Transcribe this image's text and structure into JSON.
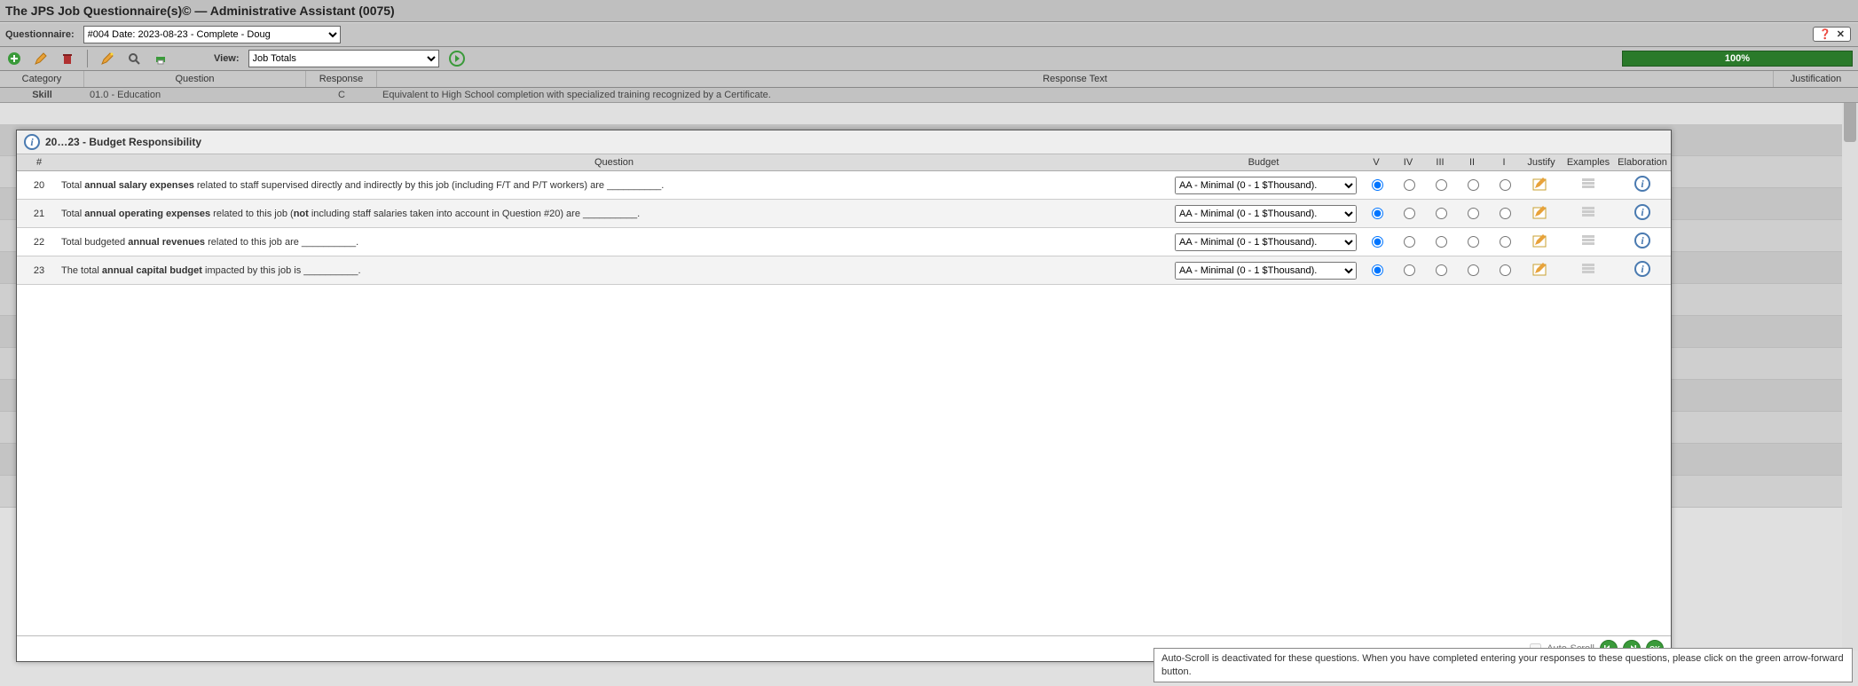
{
  "app": {
    "title": "The JPS Job Questionnaire(s)© — Administrative Assistant (0075)"
  },
  "header": {
    "questionnaire_label": "Questionnaire:",
    "questionnaire_selected": "#004 Date: 2023-08-23 - Complete - Doug",
    "help_glyph": "❓",
    "close_glyph": "✕"
  },
  "toolbar": {
    "view_label": "View:",
    "view_selected": "Job Totals",
    "progress_text": "100%",
    "icons": {
      "add": "add-icon",
      "edit": "edit-icon",
      "delete": "delete-icon",
      "wizard": "wizard-icon",
      "search": "search-icon",
      "print": "print-icon",
      "go": "go-icon"
    }
  },
  "grid": {
    "headers": {
      "category": "Category",
      "question": "Question",
      "response": "Response",
      "response_text": "Response Text",
      "justification": "Justification"
    },
    "peek_row": {
      "category": "Skill",
      "question": "01.0 - Education",
      "response": "C",
      "response_text": "Equivalent to High School completion with specialized training recognized by a Certificate."
    }
  },
  "panel": {
    "title": "20…23 - Budget Responsibility",
    "columns": {
      "num": "#",
      "question": "Question",
      "budget": "Budget",
      "v": "V",
      "iv": "IV",
      "iii": "III",
      "ii": "II",
      "i": "I",
      "justify": "Justify",
      "examples": "Examples",
      "elaboration": "Elaboration"
    },
    "budget_option": "AA - Minimal (0 - 1 $Thousand).",
    "rows": [
      {
        "num": "20",
        "q_pre": "Total ",
        "q_bold": "annual salary expenses",
        "q_post": " related to staff supervised directly and indirectly by this job (including F/T and P/T workers) are __________."
      },
      {
        "num": "21",
        "q_pre": "Total ",
        "q_bold": "annual operating expenses",
        "q_mid": " related to this job (",
        "q_bold2": "not",
        "q_post": " including staff salaries taken into account in Question #20) are __________."
      },
      {
        "num": "22",
        "q_pre": "Total budgeted ",
        "q_bold": "annual revenues",
        "q_post": " related to this job are __________."
      },
      {
        "num": "23",
        "q_pre": "The total ",
        "q_bold": "annual capital budget",
        "q_post": " impacted by this job is  __________."
      }
    ],
    "footer": {
      "autoscroll_label": "Auto-Scroll",
      "back_glyph": "◀",
      "fwd_glyph": "▶",
      "ok_label": "OK"
    }
  },
  "status": {
    "message": "Auto-Scroll is deactivated for these questions.  When you have completed entering your responses to these questions, please click on the green arrow-forward button."
  }
}
